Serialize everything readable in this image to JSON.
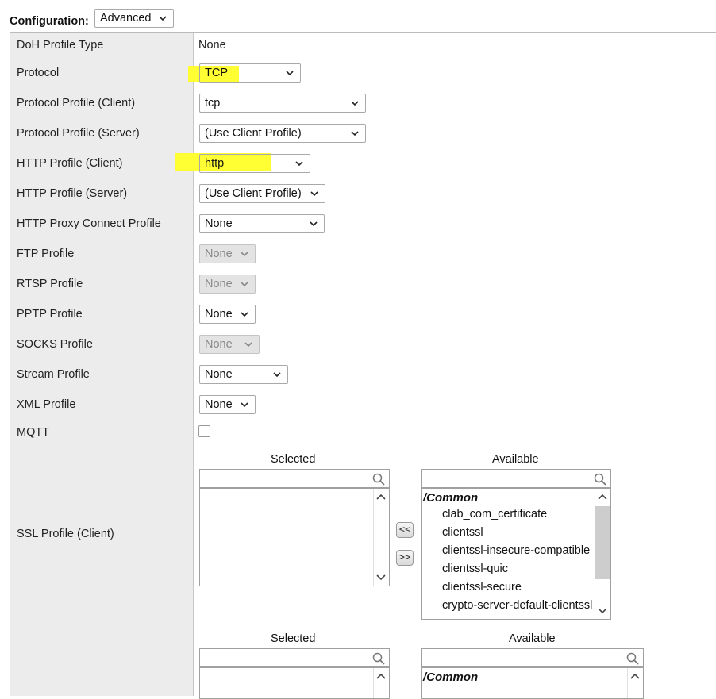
{
  "config": {
    "label": "Configuration:",
    "mode_value": "Advanced"
  },
  "rows": [
    {
      "label": "DoH Profile Type",
      "value": "None"
    },
    {
      "label": "Protocol",
      "value": "TCP"
    },
    {
      "label": "Protocol Profile (Client)",
      "value": "tcp"
    },
    {
      "label": "Protocol Profile (Server)",
      "value": "(Use Client Profile)"
    },
    {
      "label": "HTTP Profile (Client)",
      "value": "http"
    },
    {
      "label": "HTTP Profile (Server)",
      "value": "(Use Client Profile)"
    },
    {
      "label": "HTTP Proxy Connect Profile",
      "value": "None"
    },
    {
      "label": "FTP Profile",
      "value": "None"
    },
    {
      "label": "RTSP Profile",
      "value": "None"
    },
    {
      "label": "PPTP Profile",
      "value": "None"
    },
    {
      "label": "SOCKS Profile",
      "value": "None"
    },
    {
      "label": "Stream Profile",
      "value": "None"
    },
    {
      "label": "XML Profile",
      "value": "None"
    },
    {
      "label": "MQTT",
      "value": ""
    }
  ],
  "ssl_client": {
    "label": "SSL Profile (Client)",
    "selected_caption": "Selected",
    "available_caption": "Available",
    "move_left": "<<",
    "move_right": ">>",
    "group": "/Common",
    "available": [
      "clab_com_certificate",
      "clientssl",
      "clientssl-insecure-compatible",
      "clientssl-quic",
      "clientssl-secure",
      "crypto-server-default-clientssl"
    ]
  },
  "ssl_server": {
    "selected_caption": "Selected",
    "available_caption": "Available",
    "group": "/Common"
  },
  "highlight_color": "#ffff33"
}
